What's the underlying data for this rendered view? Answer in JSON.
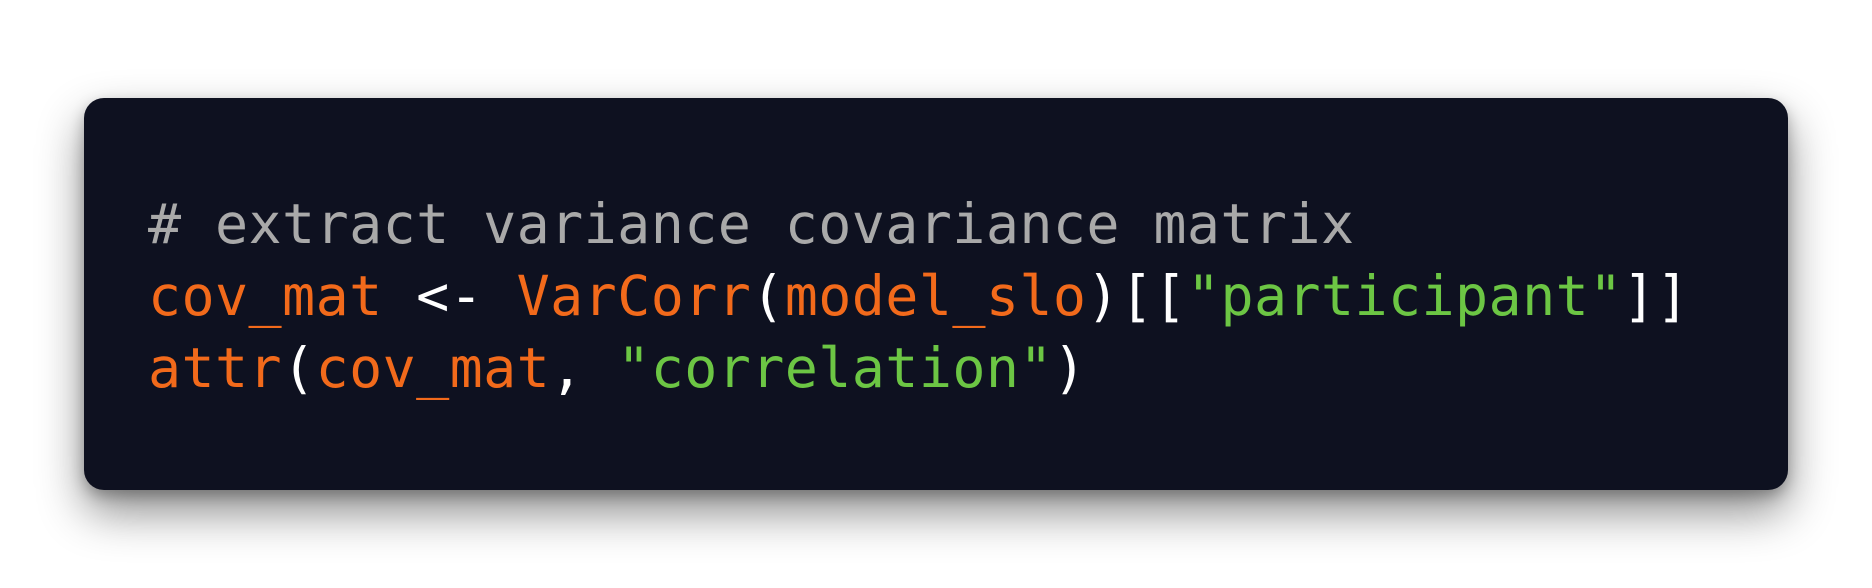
{
  "theme": {
    "page_background": "#ffffff",
    "card_background": "#0e1120",
    "comment_color": "#a9a9a9",
    "identifier_color": "#f26a1b",
    "operator_color": "#ffffff",
    "string_color": "#6cc644"
  },
  "code": {
    "language": "R",
    "lines": [
      {
        "tokens": [
          {
            "type": "comment",
            "text": "# extract variance covariance matrix"
          }
        ]
      },
      {
        "tokens": [
          {
            "type": "ident",
            "text": "cov_mat"
          },
          {
            "type": "op",
            "text": " <- "
          },
          {
            "type": "func",
            "text": "VarCorr"
          },
          {
            "type": "punct",
            "text": "("
          },
          {
            "type": "ident",
            "text": "model_slo"
          },
          {
            "type": "punct",
            "text": ")[["
          },
          {
            "type": "string",
            "text": "\"participant\""
          },
          {
            "type": "punct",
            "text": "]]"
          }
        ]
      },
      {
        "tokens": [
          {
            "type": "func",
            "text": "attr"
          },
          {
            "type": "punct",
            "text": "("
          },
          {
            "type": "ident",
            "text": "cov_mat"
          },
          {
            "type": "punct",
            "text": ", "
          },
          {
            "type": "string",
            "text": "\"correlation\""
          },
          {
            "type": "punct",
            "text": ")"
          }
        ]
      }
    ]
  }
}
